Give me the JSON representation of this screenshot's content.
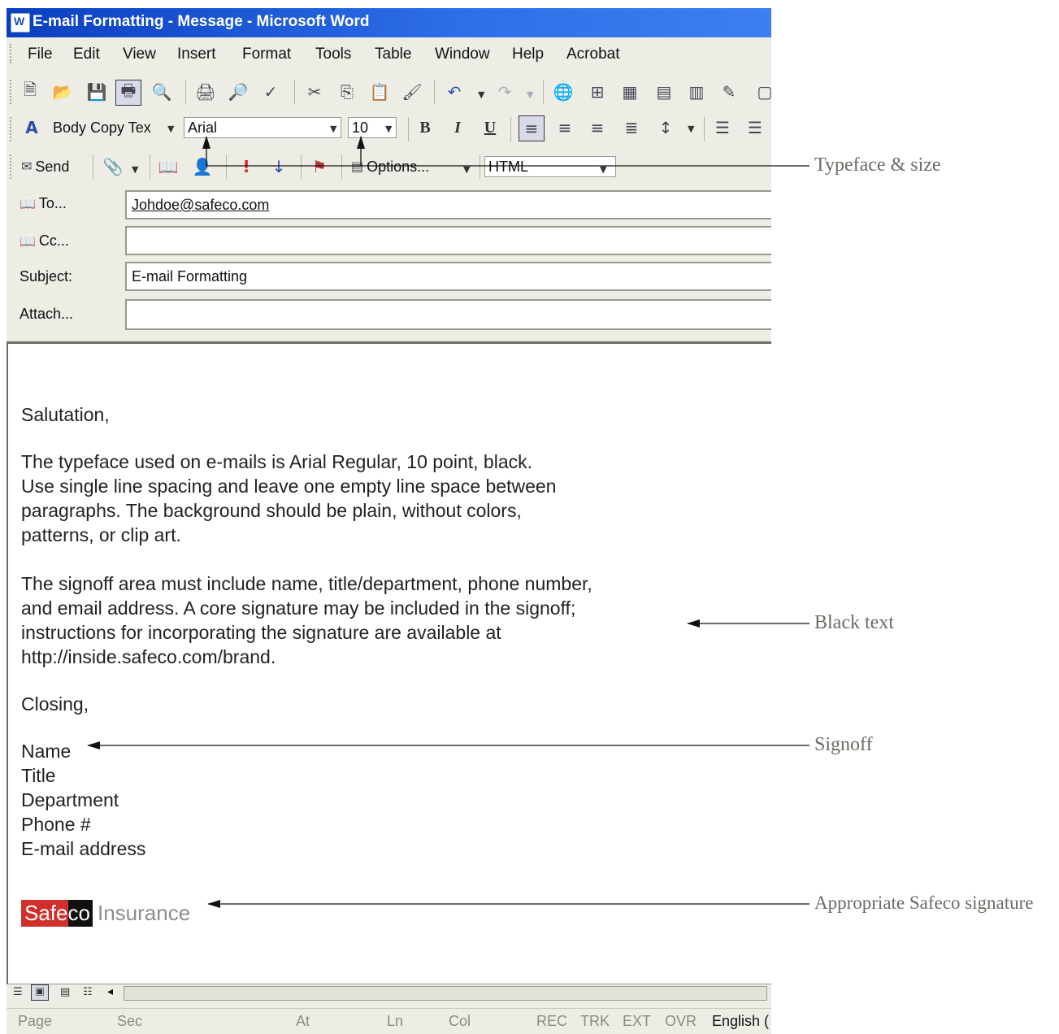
{
  "window": {
    "title": "E-mail Formatting - Message - Microsoft Word"
  },
  "menu": [
    "File",
    "Edit",
    "View",
    "Insert",
    "Format",
    "Tools",
    "Table",
    "Window",
    "Help",
    "Acrobat"
  ],
  "formatting": {
    "style": "Body Copy Tex",
    "font": "Arial",
    "size": "10"
  },
  "email_toolbar": {
    "send": "Send",
    "options": "Options...",
    "format": "HTML"
  },
  "header": {
    "to_label": "To...",
    "to_value": "Johdoe@safeco.com",
    "cc_label": "Cc...",
    "cc_value": "",
    "subject_label": "Subject:",
    "subject_value": "E-mail Formatting",
    "attach_label": "Attach...",
    "attach_value": ""
  },
  "body": {
    "lines": [
      "Salutation,",
      "The typeface used on e-mails is Arial Regular, 10 point, black.",
      "Use single line spacing and leave one empty line space between",
      "paragraphs. The background should be plain, without colors,",
      "patterns, or clip art.",
      "The signoff area must include name, title/department, phone number,",
      "and email address. A core signature may be included in the signoff;",
      "instructions for incorporating the signature are available at",
      "http://inside.safeco.com/brand.",
      "Closing,",
      "Name",
      "Title",
      "Department",
      "Phone #",
      "E-mail address"
    ],
    "signature": {
      "part1": "Safe",
      "part2": "co",
      "part3": "Insurance"
    }
  },
  "status": [
    "Page",
    "Sec",
    "At",
    "Ln",
    "Col",
    "REC",
    "TRK",
    "EXT",
    "OVR",
    "English ("
  ],
  "callouts": [
    "Typeface & size",
    "Black text",
    "Signoff",
    "Appropriate Safeco signature"
  ],
  "colors": {
    "titlebar": "#0a3fc0",
    "signature_red": "#d02f2c",
    "callout": "#6d6b64"
  }
}
